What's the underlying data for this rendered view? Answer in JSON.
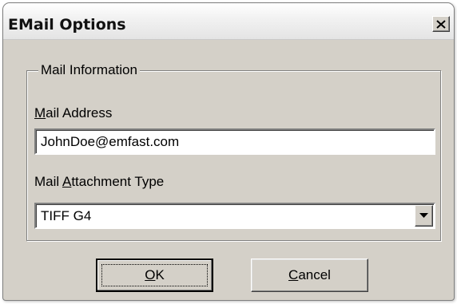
{
  "window": {
    "title": "EMail Options",
    "close_label": "Close"
  },
  "group": {
    "legend": "Mail Information"
  },
  "mail_address": {
    "label_mnemonic": "M",
    "label_rest": "ail Address",
    "value": "JohnDoe@emfast.com"
  },
  "attachment": {
    "label_prefix": "Mail ",
    "label_mnemonic": "A",
    "label_rest": "ttachment Type",
    "selected": "TIFF G4"
  },
  "buttons": {
    "ok_mnemonic": "O",
    "ok_rest": "K",
    "cancel_mnemonic": "C",
    "cancel_rest": "ancel"
  },
  "colors": {
    "dialog_face": "#d4d0c8",
    "title_bar": "#f0f0f0"
  },
  "icons": {
    "close": "close-icon",
    "dropdown": "chevron-down-icon"
  }
}
